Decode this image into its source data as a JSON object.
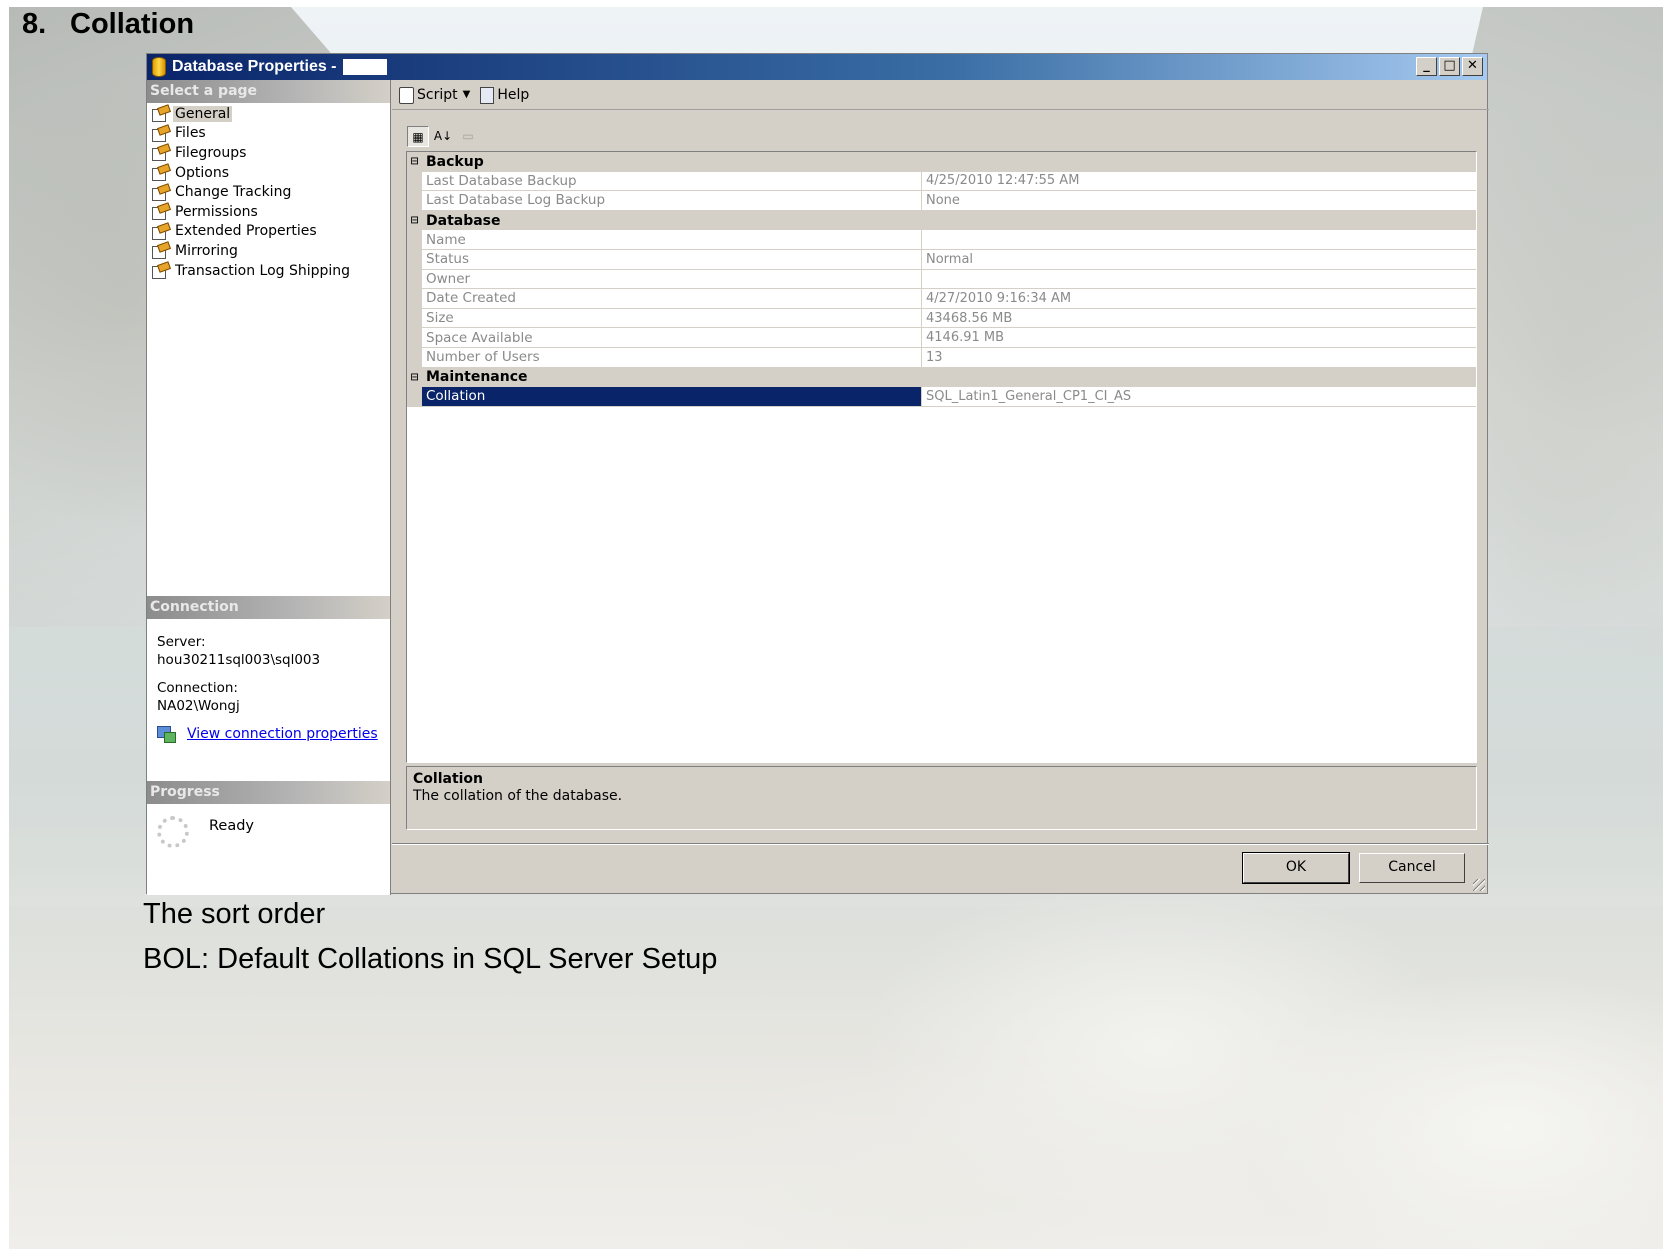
{
  "slide": {
    "number": "8.",
    "title": "Collation",
    "captions": [
      "The sort order",
      "BOL: Default Collations in SQL Server Setup"
    ]
  },
  "dialog": {
    "title": "Database Properties -",
    "window_buttons": {
      "minimize": "_",
      "maximize": "□",
      "close": "✕"
    },
    "select_page_header": "Select a page",
    "pages": [
      {
        "label": "General",
        "selected": true
      },
      {
        "label": "Files"
      },
      {
        "label": "Filegroups"
      },
      {
        "label": "Options"
      },
      {
        "label": "Change Tracking"
      },
      {
        "label": "Permissions"
      },
      {
        "label": "Extended Properties"
      },
      {
        "label": "Mirroring"
      },
      {
        "label": "Transaction Log Shipping"
      }
    ],
    "connection": {
      "header": "Connection",
      "server_label": "Server:",
      "server_value": "hou30211sql003\\sql003",
      "connection_label": "Connection:",
      "connection_value": "NA02\\Wongj",
      "link": "View connection properties"
    },
    "progress": {
      "header": "Progress",
      "status": "Ready"
    },
    "toolbar": {
      "script": "Script",
      "help": "Help"
    },
    "grid_toolbar": {
      "categorized": "▦",
      "alphabetical": "A↓",
      "property_pages": "▭"
    },
    "categories": [
      {
        "name": "Backup",
        "toggle": "⊟",
        "rows": [
          {
            "name": "Last Database Backup",
            "value": "4/25/2010 12:47:55 AM"
          },
          {
            "name": "Last Database Log Backup",
            "value": "None"
          }
        ]
      },
      {
        "name": "Database",
        "toggle": "⊟",
        "rows": [
          {
            "name": "Name",
            "value": ""
          },
          {
            "name": "Status",
            "value": "Normal"
          },
          {
            "name": "Owner",
            "value": ""
          },
          {
            "name": "Date Created",
            "value": "4/27/2010 9:16:34 AM"
          },
          {
            "name": "Size",
            "value": "43468.56 MB"
          },
          {
            "name": "Space Available",
            "value": "4146.91 MB"
          },
          {
            "name": "Number of Users",
            "value": "13"
          }
        ]
      },
      {
        "name": "Maintenance",
        "toggle": "⊟",
        "rows": [
          {
            "name": "Collation",
            "value": "SQL_Latin1_General_CP1_CI_AS",
            "selected": true
          }
        ]
      }
    ],
    "description": {
      "title": "Collation",
      "text": "The collation of the database."
    },
    "buttons": {
      "ok": "OK",
      "cancel": "Cancel"
    }
  }
}
